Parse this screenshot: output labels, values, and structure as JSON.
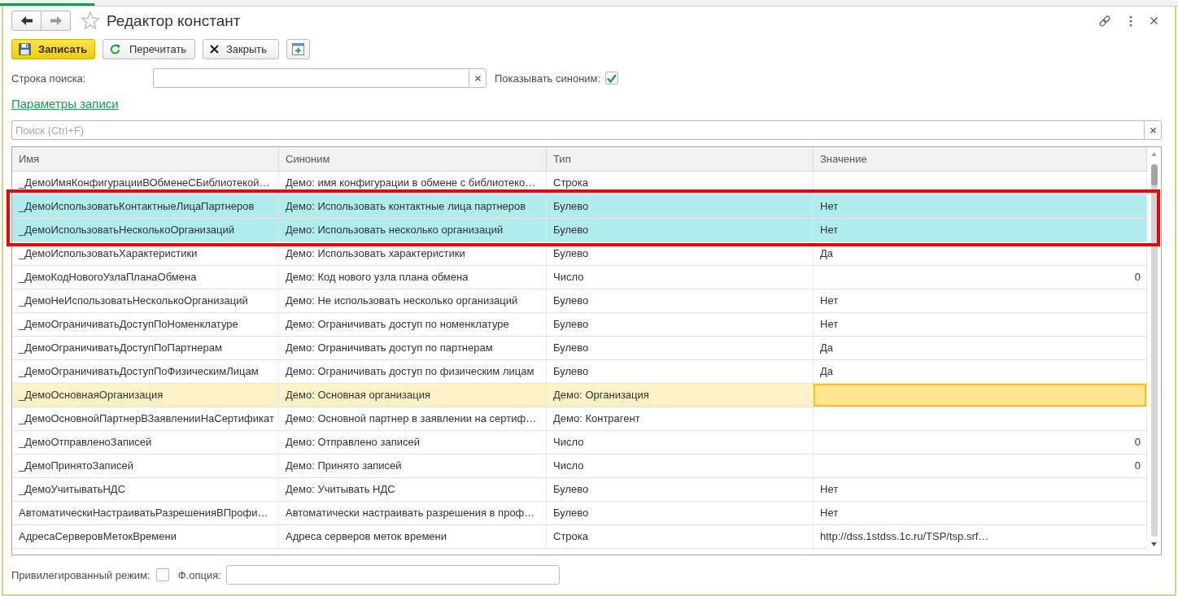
{
  "window": {
    "title": "Редактор констант",
    "favorite": false
  },
  "nav": [
    {
      "kind": "back",
      "disabled": false
    },
    {
      "kind": "forward",
      "disabled": true
    }
  ],
  "toolbar": [
    {
      "kind": "save",
      "label": "Записать",
      "default": true
    },
    {
      "kind": "reload",
      "label": "Перечитать",
      "default": false
    },
    {
      "kind": "close",
      "label": "Закрыть",
      "default": false
    },
    {
      "kind": "new-window",
      "default": false
    }
  ],
  "search_line": {
    "label": "Строка поиска:"
  },
  "show_synonym": {
    "label": "Показывать синоним:",
    "checked": true
  },
  "record_params_link": "Параметры записи",
  "table_search": {
    "placeholder": "Поиск (Ctrl+F)"
  },
  "table": {
    "columns": [
      "Имя",
      "Синоним",
      "Тип",
      "Значение"
    ],
    "rows": [
      {
        "name": "_ДемоИмяКонфигурацииВОбменеСБиблиотекой…",
        "synonym": "Демо: имя конфигурации в обмене с библиотеко…",
        "type": "Строка",
        "selected": false,
        "current": false
      },
      {
        "name": "_ДемоИспользоватьКонтактныеЛицаПартнеров",
        "synonym": "Демо: Использовать контактные лица партнеров",
        "type": "Булево",
        "value": "Нет",
        "numeric": false,
        "selected": true,
        "current": false
      },
      {
        "name": "_ДемоИспользоватьНесколькоОрганизаций",
        "synonym": "Демо: Использовать несколько организаций",
        "type": "Булево",
        "value": "Нет",
        "numeric": false,
        "selected": true,
        "current": false
      },
      {
        "name": "_ДемоИспользоватьХарактеристики",
        "synonym": "Демо: Использовать характеристики",
        "type": "Булево",
        "value": "Да",
        "numeric": false,
        "selected": false,
        "current": false
      },
      {
        "name": "_ДемоКодНовогоУзлаПланаОбмена",
        "synonym": "Демо: Код нового узла плана обмена",
        "type": "Число",
        "value": "0",
        "numeric": true,
        "selected": false,
        "current": false
      },
      {
        "name": "_ДемоНеИспользоватьНесколькоОрганизаций",
        "synonym": "Демо: Не использовать несколько организаций",
        "type": "Булево",
        "value": "Нет",
        "numeric": false,
        "selected": false,
        "current": false
      },
      {
        "name": "_ДемоОграничиватьДоступПоНоменклатуре",
        "synonym": "Демо: Ограничивать доступ по номенклатуре",
        "type": "Булево",
        "value": "Нет",
        "numeric": false,
        "selected": false,
        "current": false
      },
      {
        "name": "_ДемоОграничиватьДоступПоПартнерам",
        "synonym": "Демо: Ограничивать доступ по партнерам",
        "type": "Булево",
        "value": "Да",
        "numeric": false,
        "selected": false,
        "current": false
      },
      {
        "name": "_ДемоОграничиватьДоступПоФизическимЛицам",
        "synonym": "Демо: Ограничивать доступ по физическим лицам",
        "type": "Булево",
        "value": "Да",
        "numeric": false,
        "selected": false,
        "current": false
      },
      {
        "name": "_ДемоОсновнаяОрганизация",
        "synonym": "Демо: Основная организация",
        "type": "Демо: Организация",
        "selected": false,
        "current": true
      },
      {
        "name": "_ДемоОсновнойПартнерВЗаявленииНаСертификат",
        "synonym": "Демо: Основной партнер в заявлении на сертиф…",
        "type": "Демо: Контрагент",
        "selected": false,
        "current": false
      },
      {
        "name": "_ДемоОтправленоЗаписей",
        "synonym": "Демо: Отправлено записей",
        "type": "Число",
        "value": "0",
        "numeric": true,
        "selected": false,
        "current": false
      },
      {
        "name": "_ДемоПринятоЗаписей",
        "synonym": "Демо: Принято записей",
        "type": "Число",
        "value": "0",
        "numeric": true,
        "selected": false,
        "current": false
      },
      {
        "name": "_ДемоУчитыватьНДС",
        "synonym": "Демо: Учитывать НДС",
        "type": "Булево",
        "value": "Нет",
        "numeric": false,
        "selected": false,
        "current": false
      },
      {
        "name": "АвтоматическиНастраиватьРазрешенияВПрофи…",
        "synonym": "Автоматически настраивать разрешения в проф…",
        "type": "Булево",
        "value": "Нет",
        "numeric": false,
        "selected": false,
        "current": false
      },
      {
        "name": "АдресаСерверовМетокВремени",
        "synonym": "Адреса серверов меток времени",
        "type": "Строка",
        "value": "http://dss.1stdss.1c.ru/TSP/tsp.srf…",
        "numeric": false,
        "selected": false,
        "current": false
      }
    ]
  },
  "footer": {
    "privileged_mode": {
      "label": "Привилегированный режим:",
      "checked": false
    },
    "functional_option": {
      "label": "Ф.опция:"
    }
  }
}
